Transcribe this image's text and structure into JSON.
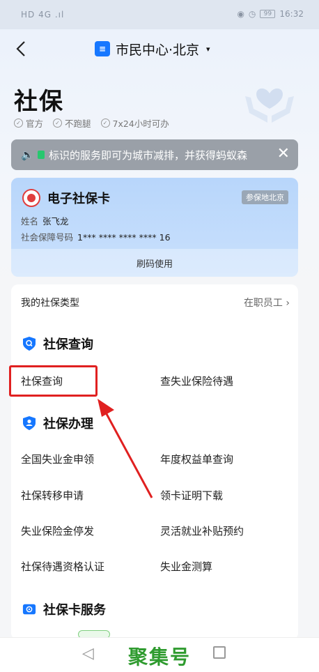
{
  "status": {
    "left": "HD 4G .ıl",
    "right_time": "16:32",
    "battery": "99"
  },
  "nav": {
    "title": "市民中心·北京",
    "caret": "▾"
  },
  "header": {
    "title": "社保",
    "tags": [
      "官方",
      "不跑腿",
      "7x24小时可办"
    ]
  },
  "notice": {
    "text": "标识的服务即可为城市减排，并获得蚂蚁森",
    "close": "✕"
  },
  "card": {
    "title": "电子社保卡",
    "region": "参保地北京",
    "name_label": "姓名",
    "name_value": "张飞龙",
    "id_label": "社会保障号码",
    "id_value": "1*** **** **** **** 16",
    "use_button": "刷码使用"
  },
  "panel": {
    "type_label": "我的社保类型",
    "type_value": "在职员工 ›",
    "section_query": "社保查询",
    "query_items": [
      "社保查询",
      "查失业保险待遇"
    ],
    "section_handle": "社保办理",
    "handle_items": [
      "全国失业金申领",
      "年度权益单查询",
      "社保转移申请",
      "领卡证明下载",
      "失业保险金停发",
      "灵活就业补贴预约",
      "社保待遇资格认证",
      "失业金测算"
    ],
    "section_card": "社保卡服务"
  },
  "bottom_nav": {
    "back": "◁",
    "watermark": "聚集号"
  },
  "colors": {
    "accent": "#1677ff",
    "highlight": "#e02020",
    "watermark": "#2f9b2f"
  }
}
